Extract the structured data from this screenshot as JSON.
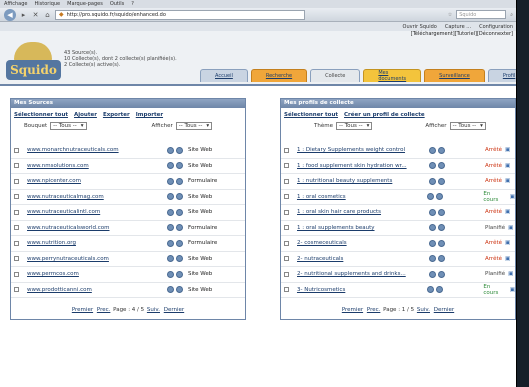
{
  "menubar": [
    "Affichage",
    "Historique",
    "Marque-pages",
    "Outils",
    "?"
  ],
  "browser": {
    "url": "http://pro.squido.fr/squido/enhanced.do",
    "search_placeholder": "Squido",
    "toolbar_items": [
      "Ouvrir Squido",
      "Capture ...",
      "Configuration"
    ]
  },
  "header_links": [
    "[Téléchargement]",
    "[Tutoriel]",
    "[Déconnexter]"
  ],
  "logo_text": "Squido",
  "stats": [
    "43 Source(s).",
    "10 Collecte(s), dont 2 collecte(s) planifiée(s).",
    "2 Collecte(s) active(s)."
  ],
  "tabs": [
    "Accueil",
    "Recherche",
    "Collecte",
    "Mes documents",
    "Surveillance",
    "Profil"
  ],
  "sources": {
    "title": "Mes Sources",
    "actions": [
      "Sélectionner tout",
      "Ajouter",
      "Exporter",
      "Importer"
    ],
    "filter_bouquet_label": "Bouquet",
    "filter_bouquet_value": "-- Tous --",
    "filter_afficher_label": "Afficher",
    "filter_afficher_value": "-- Tous --",
    "rows": [
      {
        "name": "www.monarchnutraceuticals.com",
        "type": "Site Web"
      },
      {
        "name": "www.nmsolutions.com",
        "type": "Site Web"
      },
      {
        "name": "www.npicenter.com",
        "type": "Formulaire"
      },
      {
        "name": "www.nutraceuticalmag.com",
        "type": "Site Web"
      },
      {
        "name": "www.nutraceuticalintl.com",
        "type": "Site Web"
      },
      {
        "name": "www.nutraceuticalsworld.com",
        "type": "Formulaire"
      },
      {
        "name": "www.nutrition.org",
        "type": "Formulaire"
      },
      {
        "name": "www.perrynutraceuticals.com",
        "type": "Site Web"
      },
      {
        "name": "www.permcos.com",
        "type": "Site Web"
      },
      {
        "name": "www.prodotticanni.com",
        "type": "Site Web"
      }
    ],
    "pager": {
      "first": "Premier",
      "prev": "Prec.",
      "page": "Page : 4 / 5",
      "next": "Suiv.",
      "last": "Dernier"
    }
  },
  "profiles": {
    "title": "Mes profils de collecte",
    "actions": [
      "Sélectionner tout",
      "Créer un profil de collecte"
    ],
    "filter_theme_label": "Thème",
    "filter_theme_value": "-- Tous --",
    "filter_afficher_label": "Afficher",
    "filter_afficher_value": "-- Tous --",
    "rows": [
      {
        "name": "1 : Dietary Supplements weight control",
        "status": "Arrêté"
      },
      {
        "name": "1 : food supplement skin hydration wr...",
        "status": "Arrêté"
      },
      {
        "name": "1 : nutritional beauty supplements",
        "status": "Arrêté"
      },
      {
        "name": "1 : oral cosmetics",
        "status": "En cours"
      },
      {
        "name": "1 : oral skin hair care products",
        "status": "Arrêté"
      },
      {
        "name": "1 : oral supplements beauty",
        "status": "Planifié"
      },
      {
        "name": "2- cosmeceuticals",
        "status": "Arrêté"
      },
      {
        "name": "2- nutraceuticals",
        "status": "Arrêté"
      },
      {
        "name": "2- nutritional supplements and drinks...",
        "status": "Planifié"
      },
      {
        "name": "3- Nutricosmetics",
        "status": "En cours"
      }
    ],
    "pager": {
      "first": "Premier",
      "prev": "Prec.",
      "page": "Page : 1 / 5",
      "next": "Suiv.",
      "last": "Dernier"
    }
  },
  "status_colors": {
    "Arrêté": "#cc3311",
    "En cours": "#2e8b3a",
    "Planifié": "#444444"
  }
}
